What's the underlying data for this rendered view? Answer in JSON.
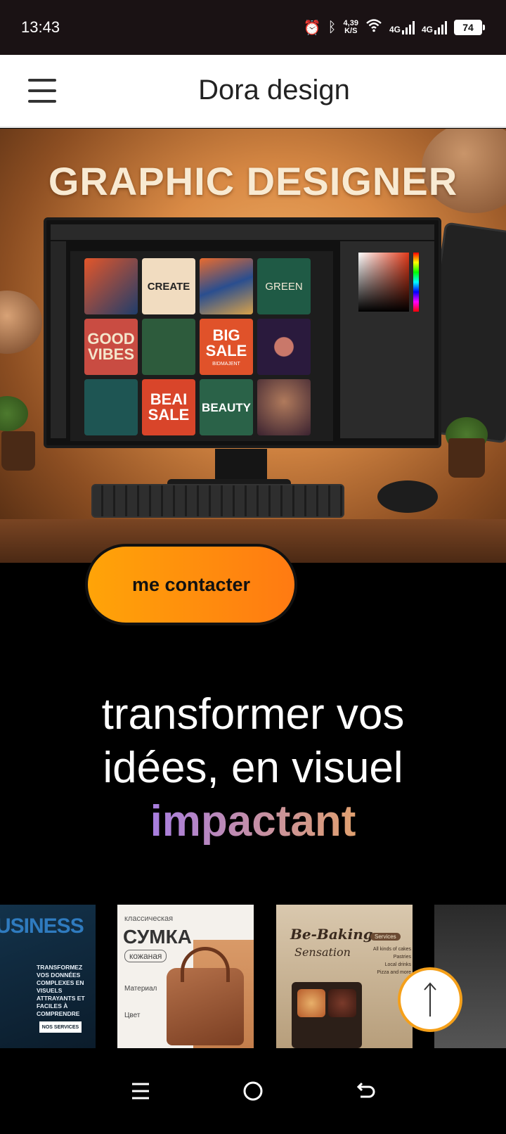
{
  "status_bar": {
    "time": "13:43",
    "net_speed_value": "4,39",
    "net_speed_unit": "K/S",
    "sim1": "4G",
    "sim2": "4G",
    "battery": "74",
    "icons": [
      "alarm-icon",
      "bluetooth-icon",
      "wifi-icon",
      "signal-icon",
      "battery-icon"
    ]
  },
  "header": {
    "menu_icon": "hamburger-icon",
    "title": "Dora design"
  },
  "hero": {
    "title": "GRAPHIC DESIGNER",
    "tiles": [
      "",
      "CREATE",
      "",
      "GREEN",
      "GOOD VIBES",
      "",
      "BIG SALE",
      "",
      "",
      "BEAI SALE",
      "BEAUTY",
      ""
    ],
    "tile_sub": "BIDMAJENT"
  },
  "cta": {
    "contact_label": "me contacter"
  },
  "tagline": {
    "line1": "transformer vos",
    "line2": "idées, en visuel",
    "accent": "impactant"
  },
  "gallery": {
    "card1": {
      "title": "USINESS",
      "body": "TRANSFORMEZ VOS DONNÉES COMPLEXES EN VISUELS ATTRAYANTS ET FACILES À COMPRENDRE",
      "button": "NOS SERVICES"
    },
    "card2": {
      "kicker": "классическая",
      "title": "СУМКА",
      "badge": "кожаная",
      "spec1": "Материал",
      "spec2": "Цвет"
    },
    "card3": {
      "title": "Be-Baking",
      "subtitle": "Sensation",
      "badge": "Services",
      "items": [
        "All kinds of cakes",
        "Pastries",
        "Local drinks",
        "Pizza and more"
      ]
    }
  },
  "scroll_top_icon": "arrow-up-icon",
  "nav_bar": {
    "icons": [
      "recents-icon",
      "home-icon",
      "back-icon"
    ]
  },
  "colors": {
    "accent_orange": "#ffa408",
    "accent_purple": "#a77de0",
    "status_bg": "#1a1214"
  }
}
